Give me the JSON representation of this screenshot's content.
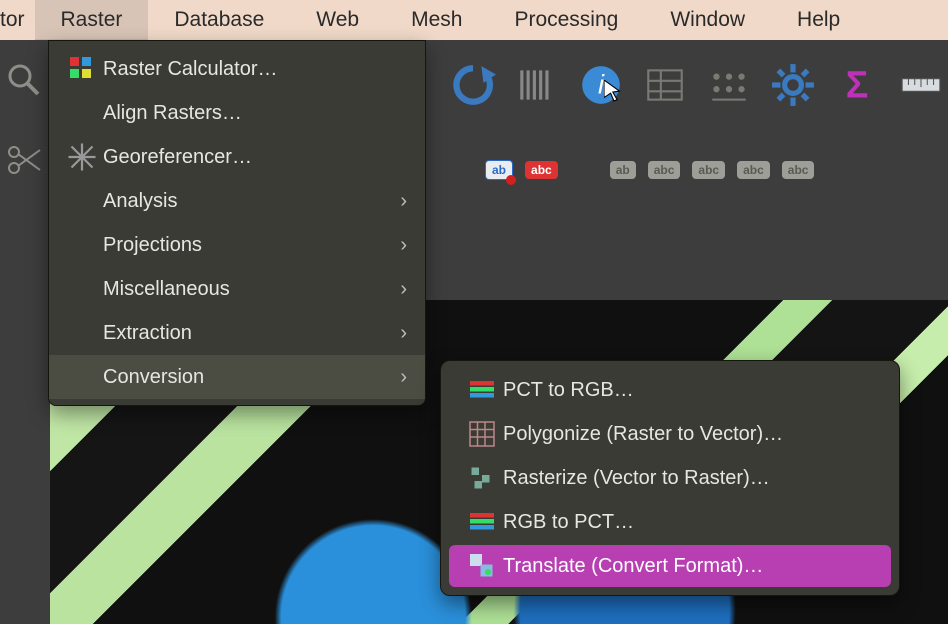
{
  "menubar": {
    "partial": "tor",
    "items": [
      "Raster",
      "Database",
      "Web",
      "Mesh",
      "Processing",
      "Window",
      "Help"
    ],
    "active_index": 0
  },
  "dropdown": {
    "items": [
      {
        "icon": "calculator-icon",
        "label": "Raster Calculator…",
        "has_submenu": false
      },
      {
        "icon": "",
        "label": "Align Rasters…",
        "has_submenu": false
      },
      {
        "icon": "georef-icon",
        "label": "Georeferencer…",
        "has_submenu": false
      },
      {
        "icon": "",
        "label": "Analysis",
        "has_submenu": true
      },
      {
        "icon": "",
        "label": "Projections",
        "has_submenu": true
      },
      {
        "icon": "",
        "label": "Miscellaneous",
        "has_submenu": true
      },
      {
        "icon": "",
        "label": "Extraction",
        "has_submenu": true
      },
      {
        "icon": "",
        "label": "Conversion",
        "has_submenu": true
      }
    ],
    "hover_index": 7
  },
  "submenu": {
    "items": [
      {
        "icon": "rgb-bars-icon",
        "label": "PCT to RGB…"
      },
      {
        "icon": "grid-icon",
        "label": "Polygonize (Raster to Vector)…"
      },
      {
        "icon": "rasterize-icon",
        "label": "Rasterize (Vector to Raster)…"
      },
      {
        "icon": "rgb-bars-icon",
        "label": "RGB to PCT…"
      },
      {
        "icon": "translate-icon",
        "label": "Translate (Convert Format)…"
      }
    ],
    "highlight_index": 4
  },
  "toolbar": {
    "icons": [
      "refresh-icon",
      "barcode-icon",
      "info-icon",
      "table-icon",
      "stats-icon",
      "gear-icon",
      "sigma-icon",
      "ruler-icon"
    ]
  },
  "toolbar2": {
    "badges": [
      {
        "text": "ab",
        "style": "blue",
        "dot": true
      },
      {
        "text": "abc",
        "style": "red",
        "dot": false
      },
      {
        "text": "ab",
        "style": "grey",
        "dot": false
      },
      {
        "text": "abc",
        "style": "grey",
        "dot": false
      },
      {
        "text": "abc",
        "style": "grey",
        "dot": false
      },
      {
        "text": "abc",
        "style": "grey",
        "dot": false
      },
      {
        "text": "abc",
        "style": "grey",
        "dot": false
      }
    ]
  },
  "colors": {
    "highlight": "#b73fb2",
    "menubar_bg": "#f0d9c8",
    "dropdown_bg": "#3a3b35"
  }
}
